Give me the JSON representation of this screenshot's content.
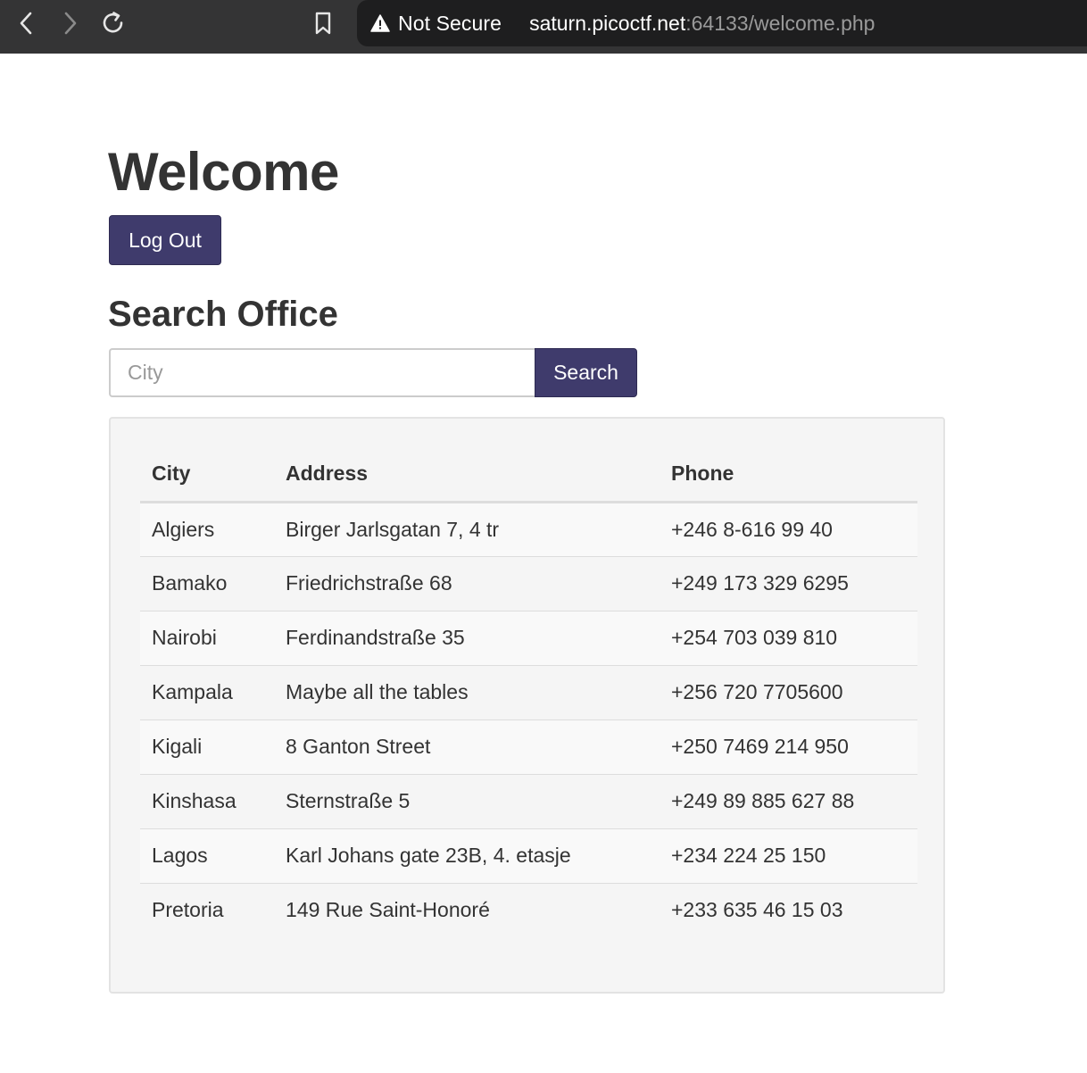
{
  "browser": {
    "security_label": "Not Secure",
    "url_host": "saturn.picoctf.net",
    "url_rest": ":64133/welcome.php",
    "icons": [
      "back-icon",
      "forward-icon",
      "reload-icon",
      "bookmark-icon",
      "warning-icon"
    ]
  },
  "page": {
    "title": "Welcome",
    "logout_label": "Log Out",
    "section_title": "Search Office",
    "search": {
      "placeholder": "City",
      "value": "",
      "button_label": "Search"
    }
  },
  "table": {
    "headers": [
      "City",
      "Address",
      "Phone"
    ],
    "rows": [
      {
        "city": "Algiers",
        "address": "Birger Jarlsgatan 7, 4 tr",
        "phone": "+246 8-616 99 40"
      },
      {
        "city": "Bamako",
        "address": "Friedrichstraße 68",
        "phone": "+249 173 329 6295"
      },
      {
        "city": "Nairobi",
        "address": "Ferdinandstraße 35",
        "phone": "+254 703 039 810"
      },
      {
        "city": "Kampala",
        "address": "Maybe all the tables",
        "phone": "+256 720 7705600"
      },
      {
        "city": "Kigali",
        "address": "8 Ganton Street",
        "phone": "+250 7469 214 950"
      },
      {
        "city": "Kinshasa",
        "address": "Sternstraße 5",
        "phone": "+249 89 885 627 88"
      },
      {
        "city": "Lagos",
        "address": "Karl Johans gate 23B, 4. etasje",
        "phone": "+234 224 25 150"
      },
      {
        "city": "Pretoria",
        "address": "149 Rue Saint-Honoré",
        "phone": "+233 635 46 15 03"
      }
    ]
  },
  "colors": {
    "primary": "#3f3b6c",
    "browser_bar": "#343435",
    "address_bar": "#1e1e1f",
    "well": "#f5f5f5",
    "text": "#333333"
  }
}
